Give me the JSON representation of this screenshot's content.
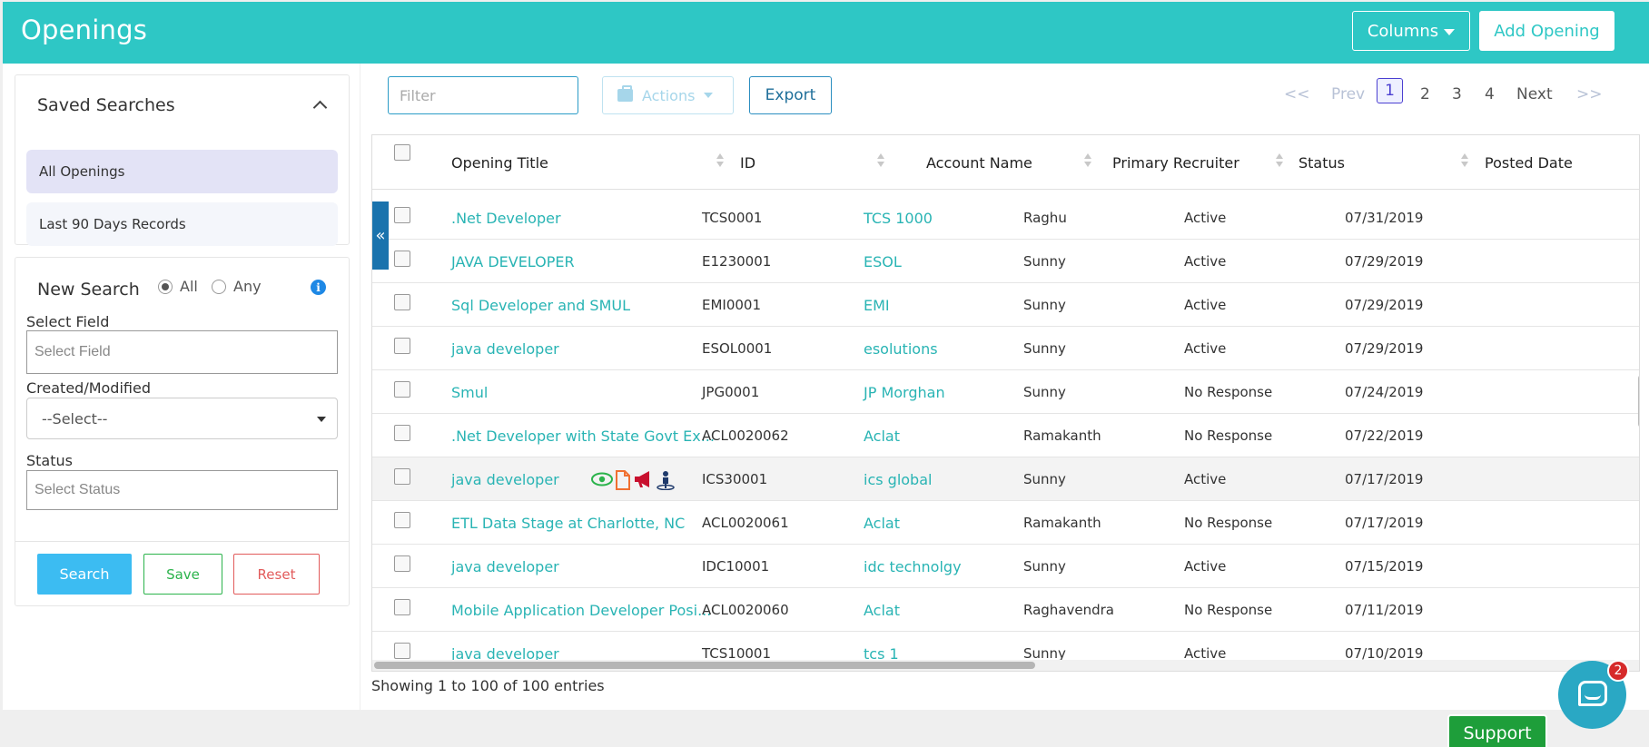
{
  "header": {
    "title": "Openings",
    "columns_label": "Columns",
    "add_label": "Add Opening"
  },
  "saved_searches": {
    "title": "Saved Searches",
    "items": [
      "All Openings",
      "Last 90 Days Records"
    ]
  },
  "new_search": {
    "title": "New Search",
    "radio_all": "All",
    "radio_any": "Any",
    "selected_mode": "All",
    "select_field_label": "Select Field",
    "select_field_placeholder": "Select Field",
    "created_label": "Created/Modified",
    "created_value": "--Select--",
    "status_label": "Status",
    "status_placeholder": "Select Status",
    "search_btn": "Search",
    "save_btn": "Save",
    "reset_btn": "Reset"
  },
  "toolbar": {
    "filter_placeholder": "Filter",
    "actions_label": "Actions",
    "export_label": "Export"
  },
  "pagination": {
    "first": "<<",
    "prev": "Prev",
    "pages": [
      "1",
      "2",
      "3",
      "4"
    ],
    "current": "1",
    "next": "Next",
    "last": ">>"
  },
  "table": {
    "headers": [
      "Opening Title",
      "ID",
      "Account Name",
      "Primary Recruiter",
      "Status",
      "Posted Date"
    ],
    "rows": [
      {
        "title": ".Net Developer",
        "id": "TCS0001",
        "account": "TCS 1000",
        "recruiter": "Raghu",
        "status": "Active",
        "date": "07/31/2019"
      },
      {
        "title": "JAVA DEVELOPER",
        "id": "E1230001",
        "account": "ESOL",
        "recruiter": "Sunny",
        "status": "Active",
        "date": "07/29/2019"
      },
      {
        "title": "Sql Developer and SMUL",
        "id": "EMI0001",
        "account": "EMI",
        "recruiter": "Sunny",
        "status": "Active",
        "date": "07/29/2019"
      },
      {
        "title": "java developer",
        "id": "ESOL0001",
        "account": "esolutions",
        "recruiter": "Sunny",
        "status": "Active",
        "date": "07/29/2019"
      },
      {
        "title": "Smul",
        "id": "JPG0001",
        "account": "JP Morghan",
        "recruiter": "Sunny",
        "status": "No Response",
        "date": "07/24/2019"
      },
      {
        "title": ".Net Developer with State Govt Ex...",
        "id": "ACL0020062",
        "account": "Aclat",
        "recruiter": "Ramakanth",
        "status": "No Response",
        "date": "07/22/2019"
      },
      {
        "title": "java developer",
        "id": "ICS30001",
        "account": "ics global",
        "recruiter": "Sunny",
        "status": "Active",
        "date": "07/17/2019"
      },
      {
        "title": "ETL Data Stage at Charlotte, NC",
        "id": "ACL0020061",
        "account": "Aclat",
        "recruiter": "Ramakanth",
        "status": "No Response",
        "date": "07/17/2019"
      },
      {
        "title": "java developer",
        "id": "IDC10001",
        "account": "idc technolgy",
        "recruiter": "Sunny",
        "status": "Active",
        "date": "07/15/2019"
      },
      {
        "title": "Mobile Application Developer Posi...",
        "id": "ACL0020060",
        "account": "Aclat",
        "recruiter": "Raghavendra",
        "status": "No Response",
        "date": "07/11/2019"
      },
      {
        "title": "java developer",
        "id": "TCS10001",
        "account": "tcs 1",
        "recruiter": "Sunny",
        "status": "Active",
        "date": "07/10/2019"
      }
    ],
    "hovered_row_index": 6,
    "row_actions": [
      "eye-icon",
      "document-icon",
      "megaphone-icon",
      "person-pin-icon"
    ]
  },
  "footer": {
    "showing": "Showing 1 to 100 of 100 entries"
  },
  "chat": {
    "badge": "2"
  },
  "support": {
    "label": "Support"
  },
  "colors": {
    "header_bg": "#2ec7c5",
    "link": "#29b4b4",
    "search_btn": "#3cbcf2",
    "save_btn": "#2bb34b",
    "reset_btn": "#e25b5b",
    "support_bg": "#1e9e3a"
  }
}
